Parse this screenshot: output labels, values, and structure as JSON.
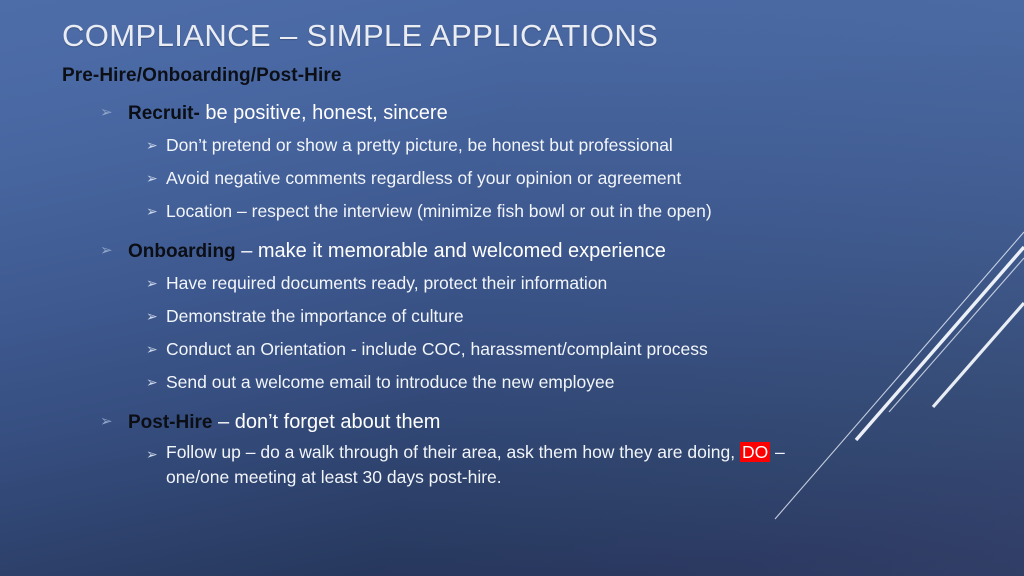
{
  "slide": {
    "title": "COMPLIANCE – SIMPLE APPLICATIONS",
    "subtitle": "Pre-Hire/Onboarding/Post-Hire",
    "highlight_color": "#ff0000",
    "title_color": "#e9ecf3",
    "lead_color": "#0c0e15",
    "body_color": "#ffffff",
    "background_top_color": "#4d6da9",
    "background_bottom_color": "#21284c",
    "bullet_glyph_level1": "➢",
    "bullet_glyph_level2": "➢"
  },
  "sections": [
    {
      "lead": "Recruit-",
      "rest": "  be positive, honest, sincere",
      "items": [
        "Don’t pretend or show a pretty picture, be honest but professional",
        "Avoid negative comments regardless of your opinion or agreement",
        "Location – respect the interview (minimize fish bowl or out in the open)"
      ]
    },
    {
      "lead": "Onboarding",
      "rest": " – make it memorable and welcomed experience",
      "items": [
        "Have required documents ready, protect their information",
        "Demonstrate the importance of culture",
        "Conduct an Orientation - include COC, harassment/complaint process",
        "Send out a welcome email to introduce the new employee"
      ]
    },
    {
      "lead": "Post-Hire",
      "rest": " – don’t forget about them",
      "items": []
    }
  ],
  "final_item": {
    "before_highlight": "Follow up – do a walk through of their area, ask them how they are doing, ",
    "highlight": "DO",
    "after_highlight": " – one/one meeting at least 30 days post-hire."
  }
}
